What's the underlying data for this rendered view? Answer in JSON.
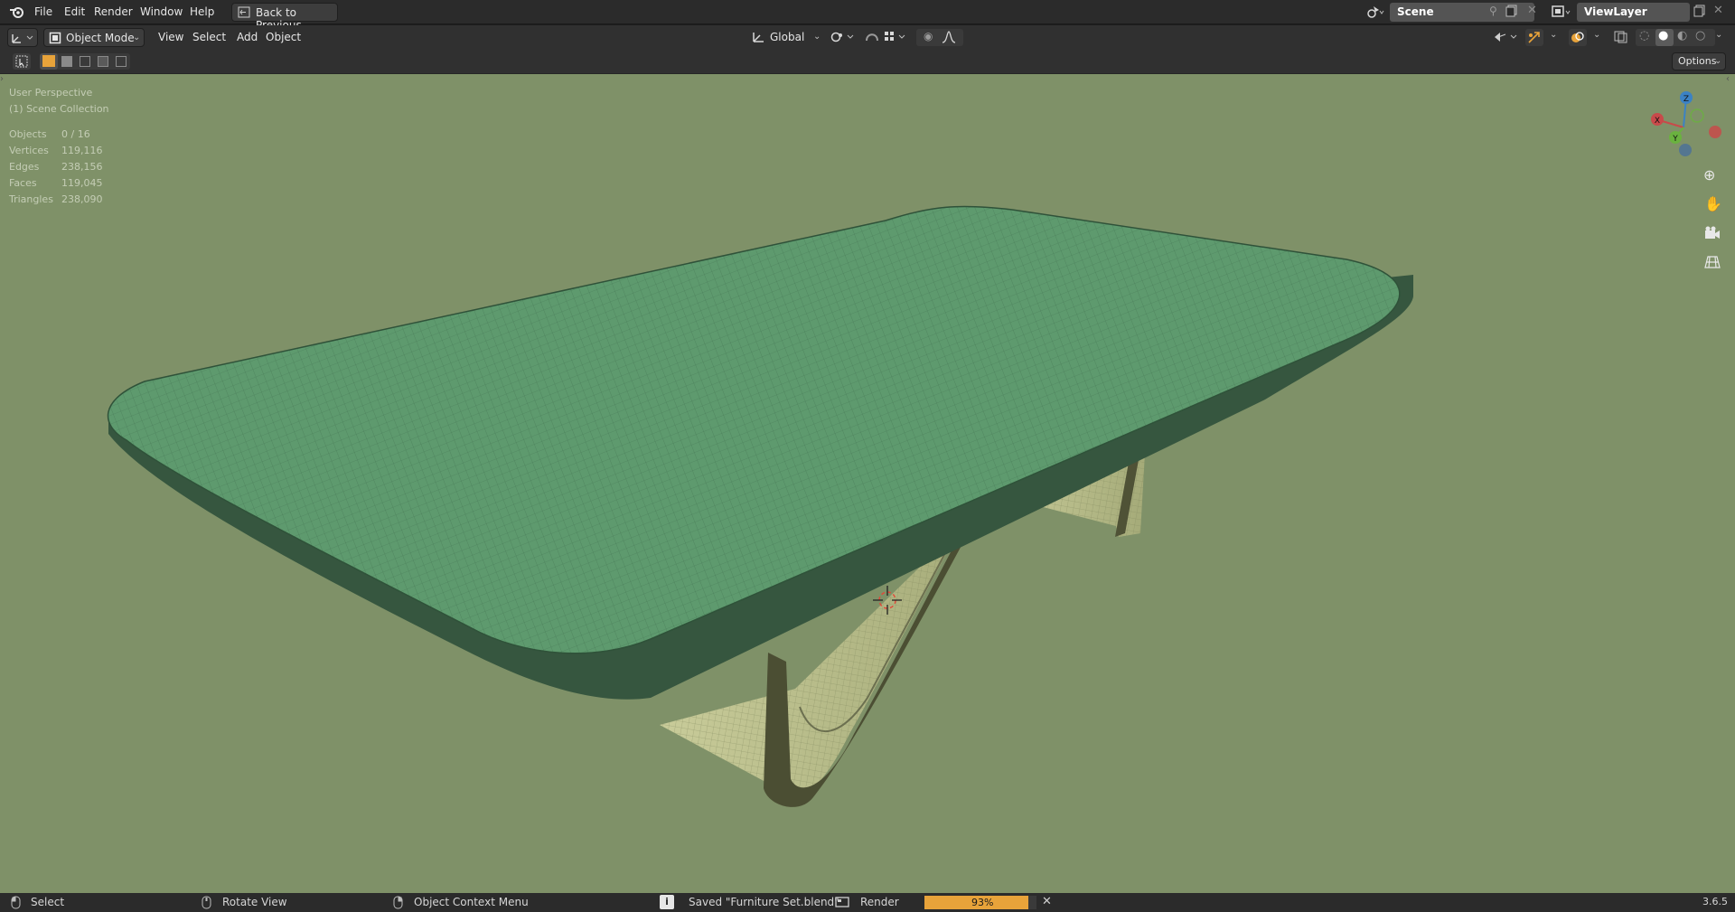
{
  "topbar": {
    "menus": [
      "File",
      "Edit",
      "Render",
      "Window",
      "Help"
    ],
    "back_button": "Back to Previous",
    "scene_name": "Scene",
    "view_layer": "ViewLayer"
  },
  "header": {
    "mode": "Object Mode",
    "menus": [
      "View",
      "Select",
      "Add",
      "Object"
    ],
    "orientation": "Global",
    "options": "Options"
  },
  "viewport": {
    "perspective": "User Perspective",
    "collection": "(1) Scene Collection",
    "stats": [
      {
        "label": "Objects",
        "value": "0 / 16"
      },
      {
        "label": "Vertices",
        "value": "119,116"
      },
      {
        "label": "Edges",
        "value": "238,156"
      },
      {
        "label": "Faces",
        "value": "119,045"
      },
      {
        "label": "Triangles",
        "value": "238,090"
      }
    ],
    "gizmo_axes": {
      "z": "Z",
      "x": "X",
      "y": "Y"
    }
  },
  "statusbar": {
    "select": "Select",
    "rotate": "Rotate View",
    "context": "Object Context Menu",
    "saved": "Saved \"Furniture Set.blend\"",
    "render": "Render",
    "progress_text": "93%",
    "progress": 0.93,
    "version": "3.6.5"
  },
  "colors": {
    "viewport_bg": "#7f9168",
    "table_top": "#5e9a6e",
    "legs": "#b5bb8c",
    "accent": "#e8a33a"
  }
}
